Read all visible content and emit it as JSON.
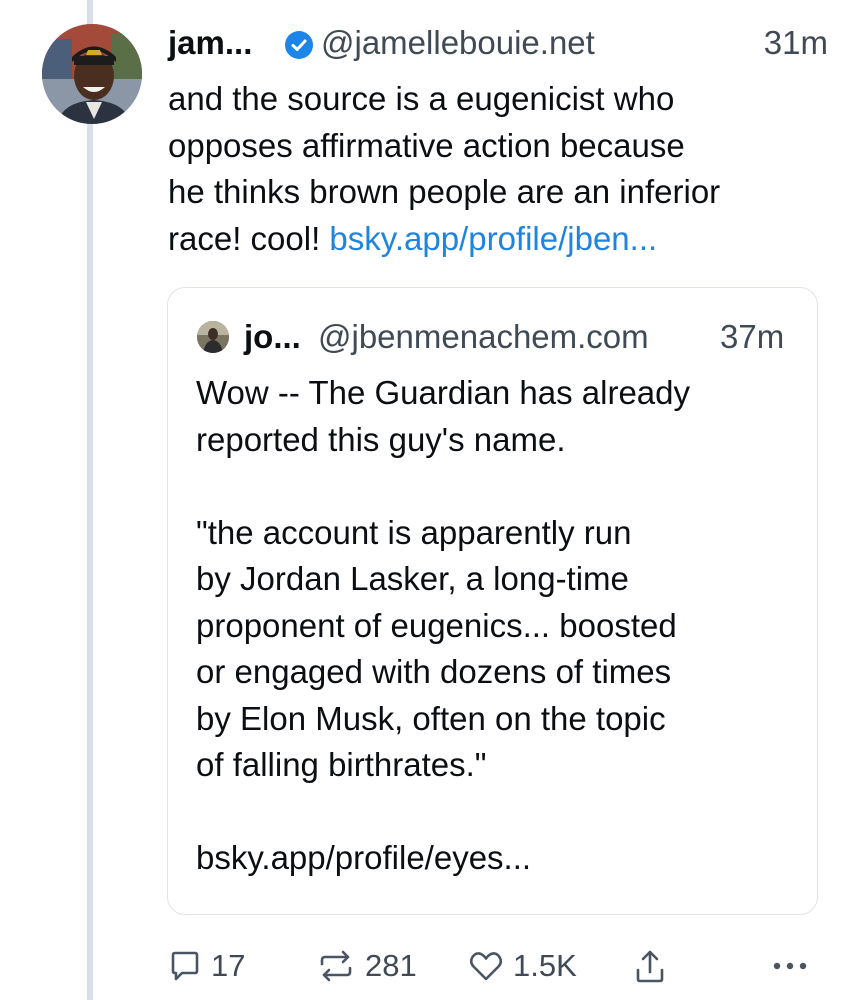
{
  "post": {
    "author": {
      "name": "jam...",
      "handle": "@jamellebouie.net",
      "avatar_icon": "profile-photo",
      "verified_icon": "verified-check-icon"
    },
    "time": "31m",
    "text": "and the source is a eugenicist who\nopposes affirmative action because\nhe thinks brown people are an inferior\nrace! cool! ",
    "link": "bsky.app/profile/jben..."
  },
  "quote": {
    "author": {
      "name": "jo...",
      "handle": "@jbenmenachem.com",
      "avatar_icon": "profile-photo"
    },
    "time": "37m",
    "text": "Wow -- The Guardian has already\nreported this guy's name.\n\n\"the account is apparently run\nby Jordan Lasker, a long-time\nproponent of eugenics... boosted\nor engaged with dozens of times\nby Elon Musk, often on the topic\nof falling birthrates.\"\n\nbsky.app/profile/eyes..."
  },
  "actions": {
    "reply": {
      "icon": "reply-icon",
      "count": "17"
    },
    "repost": {
      "icon": "repost-icon",
      "count": "281"
    },
    "like": {
      "icon": "heart-icon",
      "count": "1.5K"
    },
    "share": {
      "icon": "share-icon"
    },
    "more": {
      "icon": "more-icon"
    }
  },
  "colors": {
    "link": "#1e84e0",
    "verified": "#1d84e8",
    "muted": "#3f4a56",
    "border": "#dfe4ea",
    "thread_line": "#d9dfe6"
  }
}
